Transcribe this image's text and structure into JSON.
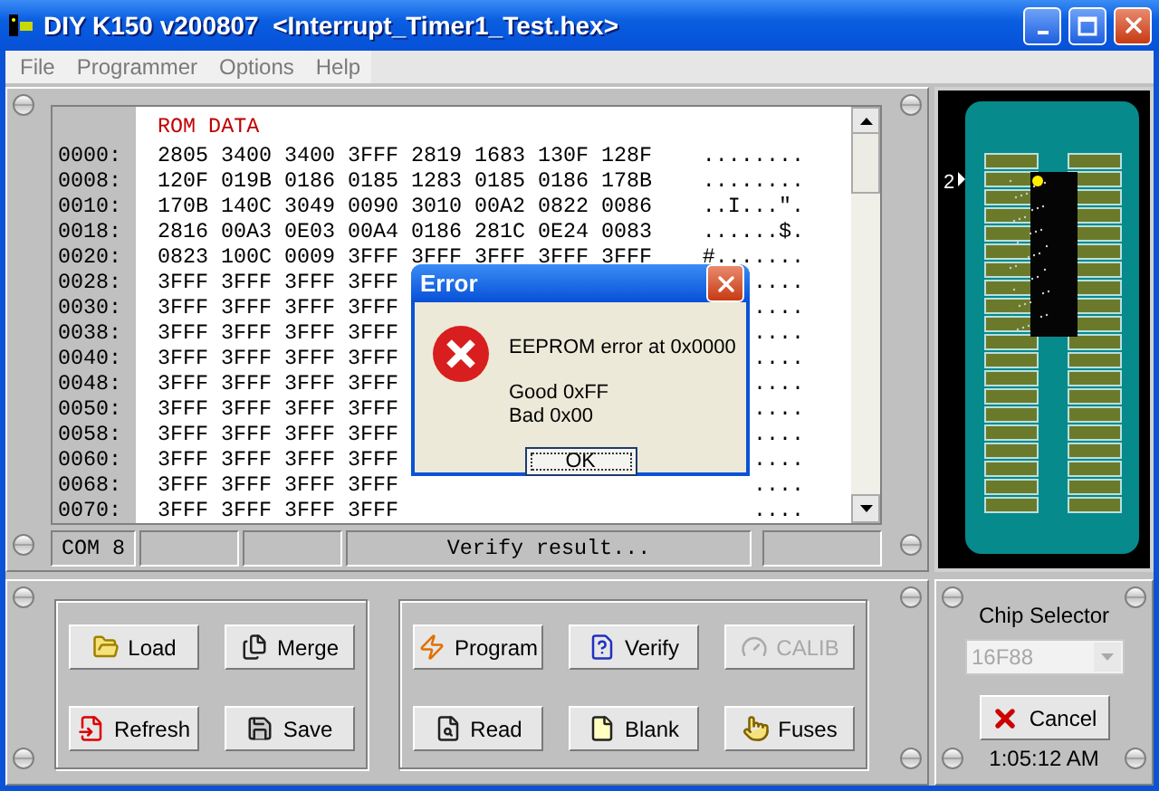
{
  "window": {
    "title": "DIY K150 v200807  <Interrupt_Timer1_Test.hex>"
  },
  "menu": [
    "File",
    "Programmer",
    "Options",
    "Help"
  ],
  "hex_view": {
    "header": "ROM DATA",
    "rows": [
      {
        "address": "0000:",
        "words": [
          "2805",
          "3400",
          "3400",
          "3FFF",
          "2819",
          "1683",
          "130F",
          "128F"
        ],
        "ascii": "........"
      },
      {
        "address": "0008:",
        "words": [
          "120F",
          "019B",
          "0186",
          "0185",
          "1283",
          "0185",
          "0186",
          "178B"
        ],
        "ascii": "........"
      },
      {
        "address": "0010:",
        "words": [
          "170B",
          "140C",
          "3049",
          "0090",
          "3010",
          "00A2",
          "0822",
          "0086"
        ],
        "ascii": "..I...\"."
      },
      {
        "address": "0018:",
        "words": [
          "2816",
          "00A3",
          "0E03",
          "00A4",
          "0186",
          "281C",
          "0E24",
          "0083"
        ],
        "ascii": "......$."
      },
      {
        "address": "0020:",
        "words": [
          "0823",
          "100C",
          "0009",
          "3FFF",
          "3FFF",
          "3FFF",
          "3FFF",
          "3FFF"
        ],
        "ascii": "#......."
      },
      {
        "address": "0028:",
        "words": [
          "3FFF",
          "3FFF",
          "3FFF",
          "3FFF"
        ],
        "ascii": "...."
      },
      {
        "address": "0030:",
        "words": [
          "3FFF",
          "3FFF",
          "3FFF",
          "3FFF"
        ],
        "ascii": "...."
      },
      {
        "address": "0038:",
        "words": [
          "3FFF",
          "3FFF",
          "3FFF",
          "3FFF"
        ],
        "ascii": "...."
      },
      {
        "address": "0040:",
        "words": [
          "3FFF",
          "3FFF",
          "3FFF",
          "3FFF"
        ],
        "ascii": "...."
      },
      {
        "address": "0048:",
        "words": [
          "3FFF",
          "3FFF",
          "3FFF",
          "3FFF"
        ],
        "ascii": "...."
      },
      {
        "address": "0050:",
        "words": [
          "3FFF",
          "3FFF",
          "3FFF",
          "3FFF"
        ],
        "ascii": "...."
      },
      {
        "address": "0058:",
        "words": [
          "3FFF",
          "3FFF",
          "3FFF",
          "3FFF"
        ],
        "ascii": "...."
      },
      {
        "address": "0060:",
        "words": [
          "3FFF",
          "3FFF",
          "3FFF",
          "3FFF"
        ],
        "ascii": "...."
      },
      {
        "address": "0068:",
        "words": [
          "3FFF",
          "3FFF",
          "3FFF",
          "3FFF"
        ],
        "ascii": "...."
      },
      {
        "address": "0070:",
        "words": [
          "3FFF",
          "3FFF",
          "3FFF",
          "3FFF"
        ],
        "ascii": "...."
      }
    ]
  },
  "status_bar": {
    "port": "COM 8",
    "message": "Verify result..."
  },
  "socket": {
    "pin_marker": "2"
  },
  "button_groups": [
    {
      "buttons": [
        {
          "label": "Load",
          "disabled": false
        },
        {
          "label": "Merge",
          "disabled": false
        },
        {
          "label": "Refresh",
          "disabled": false
        },
        {
          "label": "Save",
          "disabled": false
        }
      ]
    },
    {
      "buttons": [
        {
          "label": "Program",
          "disabled": false
        },
        {
          "label": "Verify",
          "disabled": false
        },
        {
          "label": "CALIB",
          "disabled": true
        },
        {
          "label": "Read",
          "disabled": false
        },
        {
          "label": "Blank",
          "disabled": false
        },
        {
          "label": "Fuses",
          "disabled": false
        }
      ]
    }
  ],
  "chip_selector": {
    "label": "Chip Selector",
    "value": "16F88",
    "disabled": true
  },
  "cancel_button": "Cancel",
  "clock": "1:05:12 AM",
  "dialog": {
    "title": "Error",
    "lines": [
      "EEPROM error at 0x0000",
      "Good 0xFF",
      "Bad 0x00"
    ],
    "button": "OK"
  }
}
